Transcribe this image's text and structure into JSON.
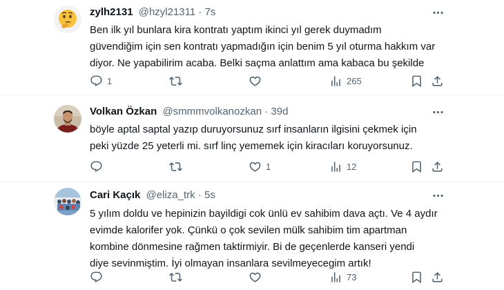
{
  "tweets": [
    {
      "name": "zylh2131",
      "handle": "@hzyl21311",
      "separator": "·",
      "time": "7s",
      "avatar_icon": "thinking-face-emoji",
      "lines": [
        "Ben ilk yıl bunlara kira kontratı yaptım ikinci yıl gerek duymadım",
        "güvendiğim için sen kontratı yapmadığın için benim 5 yıl oturma hakkım var",
        "diyor. Ne yapabilirim acaba. Belki saçma anlattım ama kabaca bu şekilde"
      ],
      "reply_count": "1",
      "retweet_count": "",
      "like_count": "",
      "view_count": "265"
    },
    {
      "name": "Volkan Özkan",
      "handle": "@smmmvolkanozkan",
      "separator": "·",
      "time": "39d",
      "avatar_icon": "person-photo-avatar",
      "lines": [
        "böyle aptal saptal yazıp duruyorsunuz sırf insanların ilgisini çekmek için",
        "peki yüzde 25 yeterli mi. sırf linç yememek için kiracıları koruyorsunuz."
      ],
      "reply_count": "",
      "retweet_count": "",
      "like_count": "1",
      "view_count": "12"
    },
    {
      "name": "Cari Kaçık",
      "handle": "@eliza_trk",
      "separator": "·",
      "time": "5s",
      "avatar_icon": "group-photo-avatar",
      "lines": [
        "5 yılım doldu ve hepinizin bayildigi cok ünlü ev sahibim dava açtı. Ve 4 aydır",
        "evimde kalorifer yok. Çünkü o çok sevilen mülk sahibim tim apartman",
        "kombine dönmesine rağmen taktirmiyir. Bi de geçenlerde kanseri yendi",
        "diye sevinmiştim. İyi olmayan insanlara sevilmeyecegim artık!"
      ],
      "reply_count": "",
      "retweet_count": "",
      "like_count": "",
      "view_count": "73"
    }
  ],
  "colors": {
    "text": "#0f1419",
    "secondary": "#536471",
    "divider": "#eff3f4",
    "icon": "#536471"
  },
  "icons": [
    "reply-icon",
    "retweet-icon",
    "like-icon",
    "views-icon",
    "bookmark-icon",
    "share-icon",
    "more-icon"
  ]
}
